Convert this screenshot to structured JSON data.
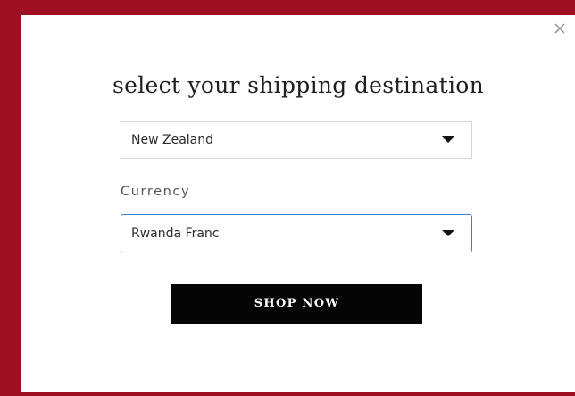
{
  "modal": {
    "title": "select your shipping destination",
    "destination": {
      "selected": "New Zealand"
    },
    "currency": {
      "label": "Currency",
      "selected": "Rwanda Franc"
    },
    "shop_now_label": "SHOP NOW",
    "close_icon": "close-icon"
  },
  "colors": {
    "backdrop": "#9e0f24",
    "modal_background": "#ffffff",
    "button_background": "#050505",
    "button_text": "#ffffff",
    "focus_border": "#3d80d0",
    "select_border": "#d6d6d6"
  }
}
